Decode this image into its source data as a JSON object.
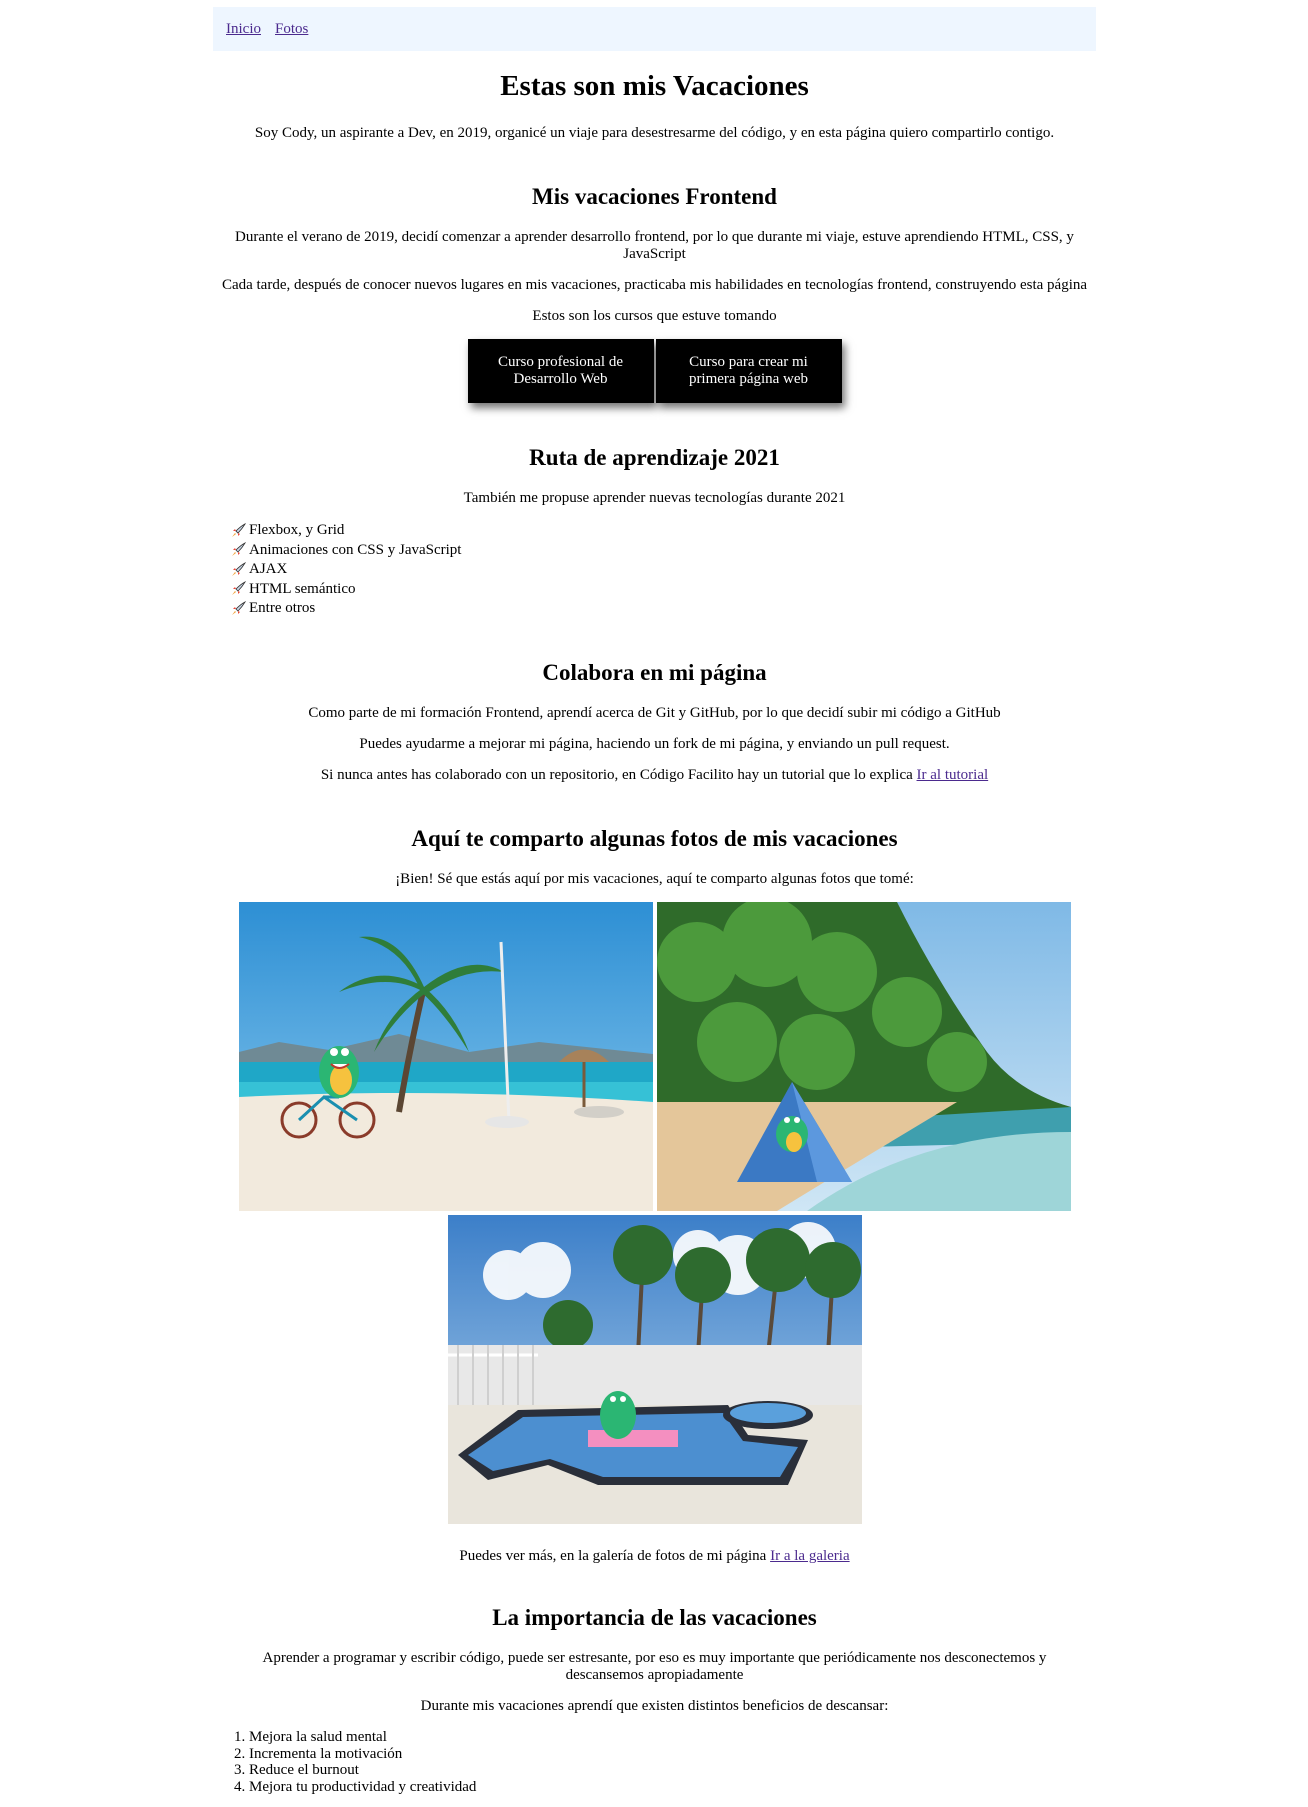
{
  "nav": {
    "links": [
      "Inicio",
      "Fotos"
    ]
  },
  "hero": {
    "title": "Estas son mis Vacaciones",
    "intro": "Soy Cody, un aspirante a Dev, en 2019, organicé un viaje para desestresarme del código, y en esta página quiero compartirlo contigo."
  },
  "frontend": {
    "title": "Mis vacaciones Frontend",
    "p1": "Durante el verano de 2019, decidí comenzar a aprender desarrollo frontend, por lo que durante mi viaje, estuve aprendiendo HTML, CSS, y JavaScript",
    "p2": "Cada tarde, después de conocer nuevos lugares en mis vacaciones, practicaba mis habilidades en tecnologías frontend, construyendo esta página",
    "p3": "Estos son los cursos que estuve tomando",
    "courses": [
      "Curso profesional de Desarrollo Web",
      "Curso para crear mi primera página web"
    ]
  },
  "ruta": {
    "title": "Ruta de aprendizaje 2021",
    "intro": "También me propuse aprender nuevas tecnologías durante 2021",
    "items": [
      "Flexbox, y Grid",
      "Animaciones con CSS y JavaScript",
      "AJAX",
      "HTML semántico",
      "Entre otros"
    ]
  },
  "colabora": {
    "title": "Colabora en mi página",
    "p1": "Como parte de mi formación Frontend, aprendí acerca de Git y GitHub, por lo que decidí subir mi código a GitHub",
    "p2": "Puedes ayudarme a mejorar mi página, haciendo un fork de mi página, y enviando un pull request.",
    "p3": "Si nunca antes has colaborado con un repositorio, en Código Facilito hay un tutorial que lo explica",
    "link": "Ir al tutorial"
  },
  "fotos": {
    "title": "Aquí te comparto algunas fotos de mis vacaciones",
    "intro": "¡Bien! Sé que estás aquí por mis vacaciones, aquí te comparto algunas fotos que tomé:",
    "more": "Puedes ver más, en la galería de fotos de mi página",
    "link": "Ir a la galeria"
  },
  "importancia": {
    "title": "La importancia de las vacaciones",
    "p1": "Aprender a programar y escribir código, puede ser estresante, por eso es muy importante que periódicamente nos desconectemos y descansemos apropiadamente",
    "p2": "Durante mis vacaciones aprendí que existen distintos beneficios de descansar:",
    "benefits": [
      "Mejora la salud mental",
      "Incrementa la motivación",
      "Reduce el burnout",
      "Mejora tu productividad y creatividad"
    ]
  },
  "colors": {
    "nav_bg": "#eef6ff",
    "link": "#4b2a8e",
    "button_bg": "#000000",
    "button_text": "#ffffff"
  },
  "icons": {
    "list_bullet": "rocket-icon"
  }
}
